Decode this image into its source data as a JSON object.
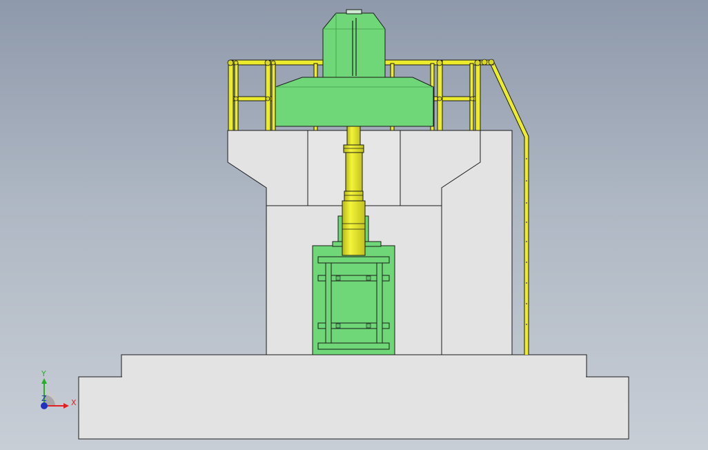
{
  "viewport": {
    "background_top": "#8e99ab",
    "background_bottom": "#c8ced6"
  },
  "model": {
    "concrete_color": "#e3e3e3",
    "equipment_color": "#6fd778",
    "railing_color": "#ecec2c",
    "edge_color": "#1a1a1a"
  },
  "triad": {
    "x_label": "X",
    "y_label": "Y",
    "z_label": "Z",
    "x_color": "#e02020",
    "y_color": "#20b020",
    "z_color": "#2030c0"
  }
}
